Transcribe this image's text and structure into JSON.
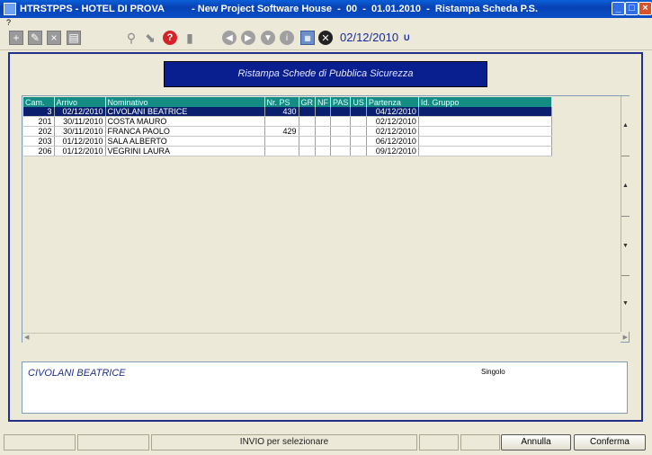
{
  "window": {
    "title": "HTRSTPPS - HOTEL DI PROVA          - New Project Software House  -  00  -  01.01.2010  -  Ristampa Scheda P.S.",
    "minimize": "_",
    "maximize": "□",
    "close": "×"
  },
  "menu": {
    "help": "?"
  },
  "toolbar": {
    "add": "+",
    "edit": "✎",
    "delete": "×",
    "save_doc": "▤",
    "search": "⚲",
    "print": "⬊",
    "help": "?",
    "disk": "▮",
    "prev": "◀",
    "next": "▶",
    "down": "▼",
    "info": "i",
    "calc": "▦",
    "exit": "✕",
    "date": "02/12/2010",
    "user": "U"
  },
  "banner": {
    "title": "Ristampa Schede di Pubblica Sicurezza"
  },
  "grid": {
    "headers": [
      "Cam.",
      "Arrivo",
      "Nominativo",
      "Nr. PS",
      "GR",
      "NF",
      "PAS",
      "US",
      "Partenza",
      "Id. Gruppo"
    ],
    "rows": [
      {
        "cam": "3",
        "arrivo": "02/12/2010",
        "nominativo": "CIVOLANI BEATRICE",
        "nrps": "430",
        "gr": "",
        "nf": "",
        "pas": "",
        "us": "",
        "partenza": "04/12/2010",
        "gruppo": ""
      },
      {
        "cam": "201",
        "arrivo": "30/11/2010",
        "nominativo": "COSTA MAURO",
        "nrps": "",
        "gr": "",
        "nf": "",
        "pas": "",
        "us": "",
        "partenza": "02/12/2010",
        "gruppo": ""
      },
      {
        "cam": "202",
        "arrivo": "30/11/2010",
        "nominativo": "FRANCA PAOLO",
        "nrps": "429",
        "gr": "",
        "nf": "",
        "pas": "",
        "us": "",
        "partenza": "02/12/2010",
        "gruppo": ""
      },
      {
        "cam": "203",
        "arrivo": "01/12/2010",
        "nominativo": "SALA ALBERTO",
        "nrps": "",
        "gr": "",
        "nf": "",
        "pas": "",
        "us": "",
        "partenza": "06/12/2010",
        "gruppo": ""
      },
      {
        "cam": "206",
        "arrivo": "01/12/2010",
        "nominativo": "VEGRINI LAURA",
        "nrps": "",
        "gr": "",
        "nf": "",
        "pas": "",
        "us": "",
        "partenza": "09/12/2010",
        "gruppo": ""
      }
    ],
    "scroll": {
      "up": "▲",
      "down": "▼",
      "left": "◀",
      "right": "▶"
    }
  },
  "info": {
    "name": "CIVOLANI BEATRICE",
    "type": "Singolo"
  },
  "status": {
    "hint": "INVIO per selezionare",
    "annulla": "Annulla",
    "conferma": "Conferma"
  },
  "colors": {
    "title_blue": "#0842b5",
    "grid_header": "#148c84",
    "selected_row": "#0a1f6e",
    "banner": "#0a1f8f"
  }
}
